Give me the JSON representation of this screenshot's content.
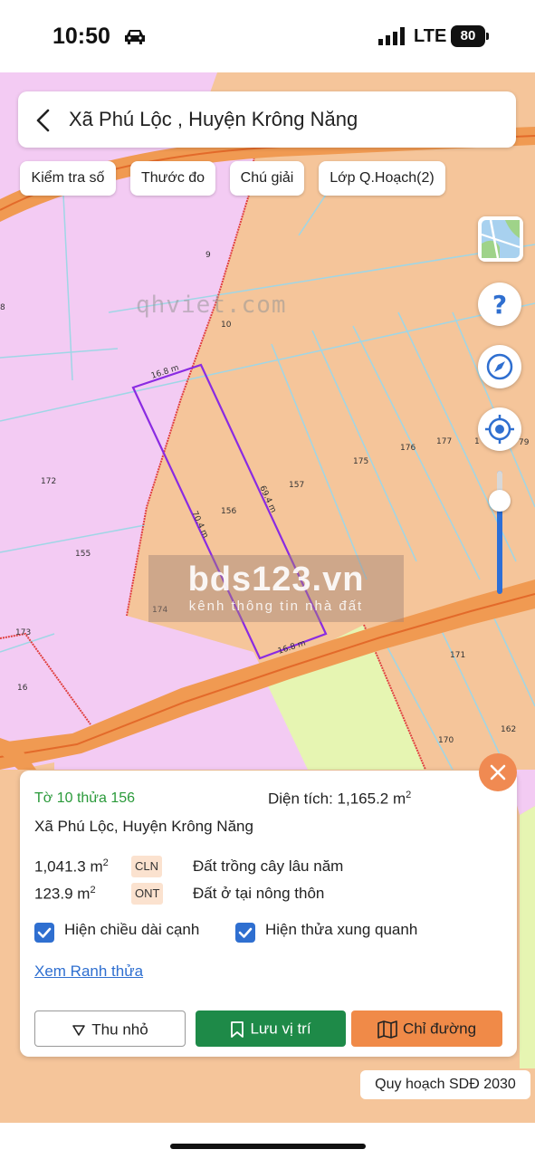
{
  "status_bar": {
    "time": "10:50",
    "network": "LTE",
    "battery": "80"
  },
  "header": {
    "title": "Xã Phú Lộc , Huyện Krông Năng"
  },
  "toolbar": {
    "buttons": [
      "Kiểm tra số",
      "Thước đo",
      "Chú giải",
      "Lớp Q.Hoạch(2)"
    ]
  },
  "map": {
    "colors": {
      "residential": "#f5c59a",
      "pink_zone": "#f3cbf3",
      "green_zone": "#e6f5b2",
      "road": "#f09a52",
      "parcel_outline": "#8a2be2"
    },
    "lot_labels": [
      "9",
      "10",
      "172",
      "155",
      "156",
      "157",
      "175",
      "176",
      "177",
      "1",
      "79",
      "174",
      "173",
      "16",
      "171",
      "170",
      "162",
      "8"
    ],
    "edge_labels": [
      "16.8 m",
      "69.4 m",
      "70.4 m",
      "16.8 m"
    ]
  },
  "watermarks": {
    "site": "qhviet.com",
    "banner_title": "bds123.vn",
    "banner_subtitle": "kênh thông tin nhà đất"
  },
  "info": {
    "parcel": "Tờ 10 thửa 156",
    "area_label": "Diện tích: 1,165.2 m",
    "area_sup": "2",
    "address": "Xã Phú Lộc, Huyện Krông Năng",
    "land_uses": [
      {
        "amount": "1,041.3 m",
        "sup": "2",
        "code": "CLN",
        "description": "Đất trồng cây lâu năm"
      },
      {
        "amount": "123.9 m",
        "sup": "2",
        "code": "ONT",
        "description": "Đất ở tại nông thôn"
      }
    ],
    "checkboxes": [
      {
        "label": "Hiện chiều dài cạnh",
        "checked": true
      },
      {
        "label": "Hiện thửa xung quanh",
        "checked": true
      }
    ],
    "link": "Xem Ranh thửa",
    "actions": {
      "collapse": "Thu nhỏ",
      "save": "Lưu vị trí",
      "directions": "Chỉ đường"
    }
  },
  "plan_label": "Quy hoạch SDĐ 2030"
}
